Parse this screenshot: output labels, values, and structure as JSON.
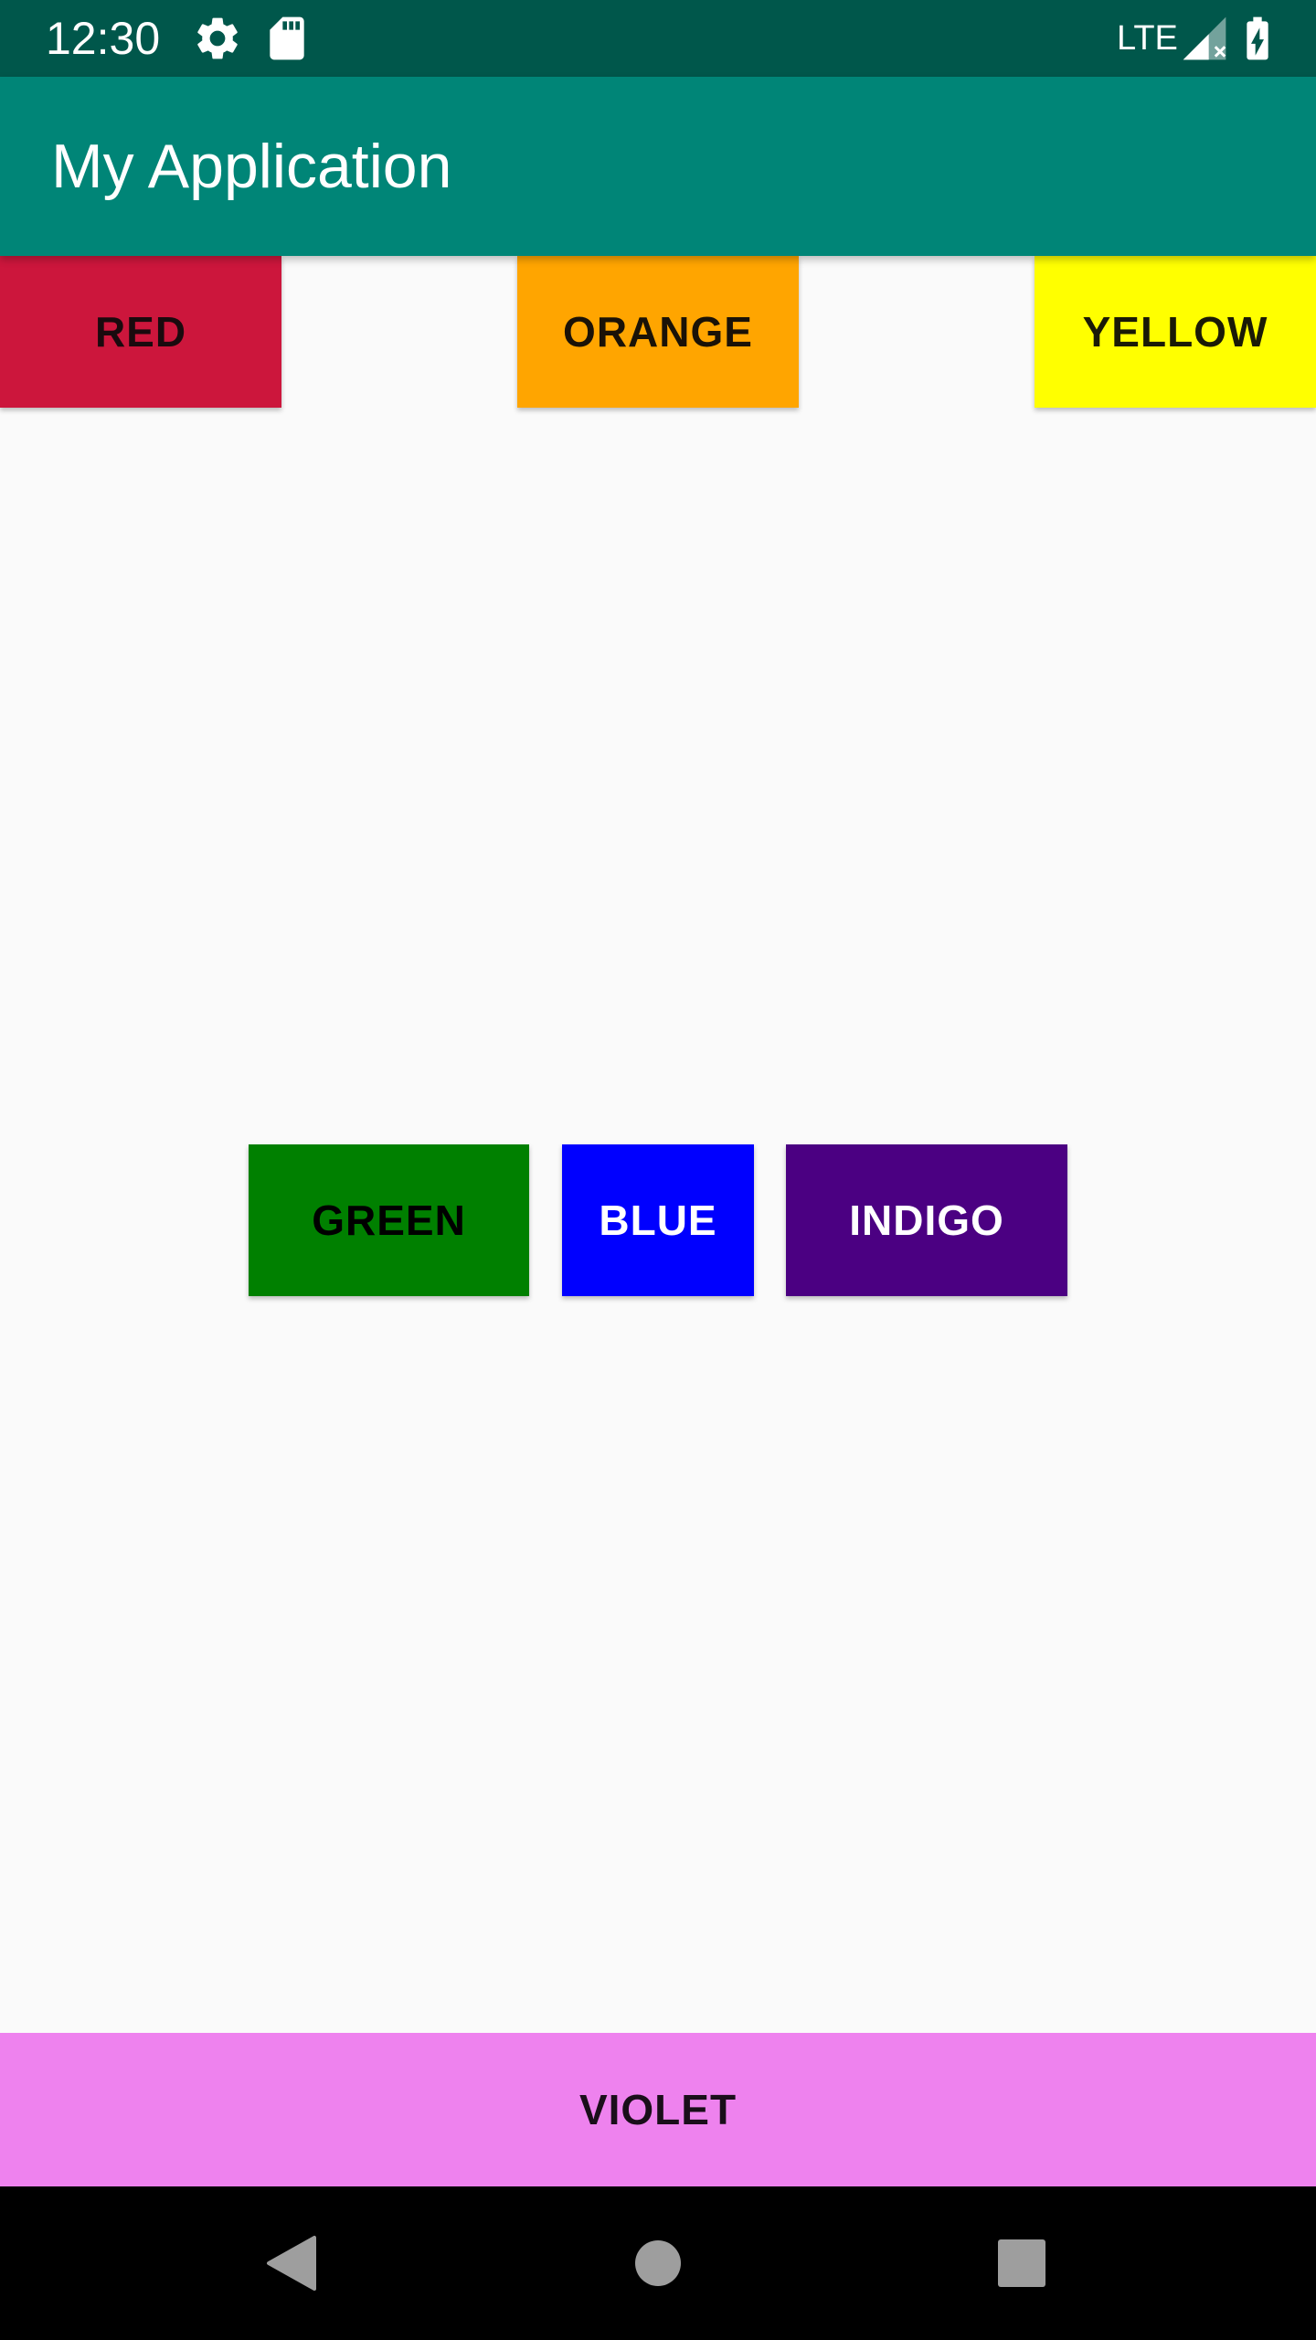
{
  "status_bar": {
    "time": "12:30",
    "network": "LTE",
    "icons": [
      "settings-icon",
      "sd-card-icon",
      "signal-icon",
      "battery-charging-icon"
    ],
    "background": "#00574b"
  },
  "app_bar": {
    "title": "My Application",
    "background": "#008577"
  },
  "buttons": {
    "red": {
      "label": "RED",
      "bg": "#cc163c",
      "fg": "#1a0a0e"
    },
    "orange": {
      "label": "ORANGE",
      "bg": "#ffa500",
      "fg": "#1a1207"
    },
    "yellow": {
      "label": "YELLOW",
      "bg": "#ffff00",
      "fg": "#1a1a06"
    },
    "green": {
      "label": "GREEN",
      "bg": "#008000",
      "fg": "#000000"
    },
    "blue": {
      "label": "BLUE",
      "bg": "#0000ff",
      "fg": "#ffffff"
    },
    "indigo": {
      "label": "INDIGO",
      "bg": "#4b0082",
      "fg": "#ffffff"
    },
    "violet": {
      "label": "VIOLET",
      "bg": "#ee82ee",
      "fg": "#1a0e1a"
    }
  },
  "nav_bar": {
    "icons": [
      "back-icon",
      "home-icon",
      "recents-icon"
    ],
    "background": "#000000"
  }
}
